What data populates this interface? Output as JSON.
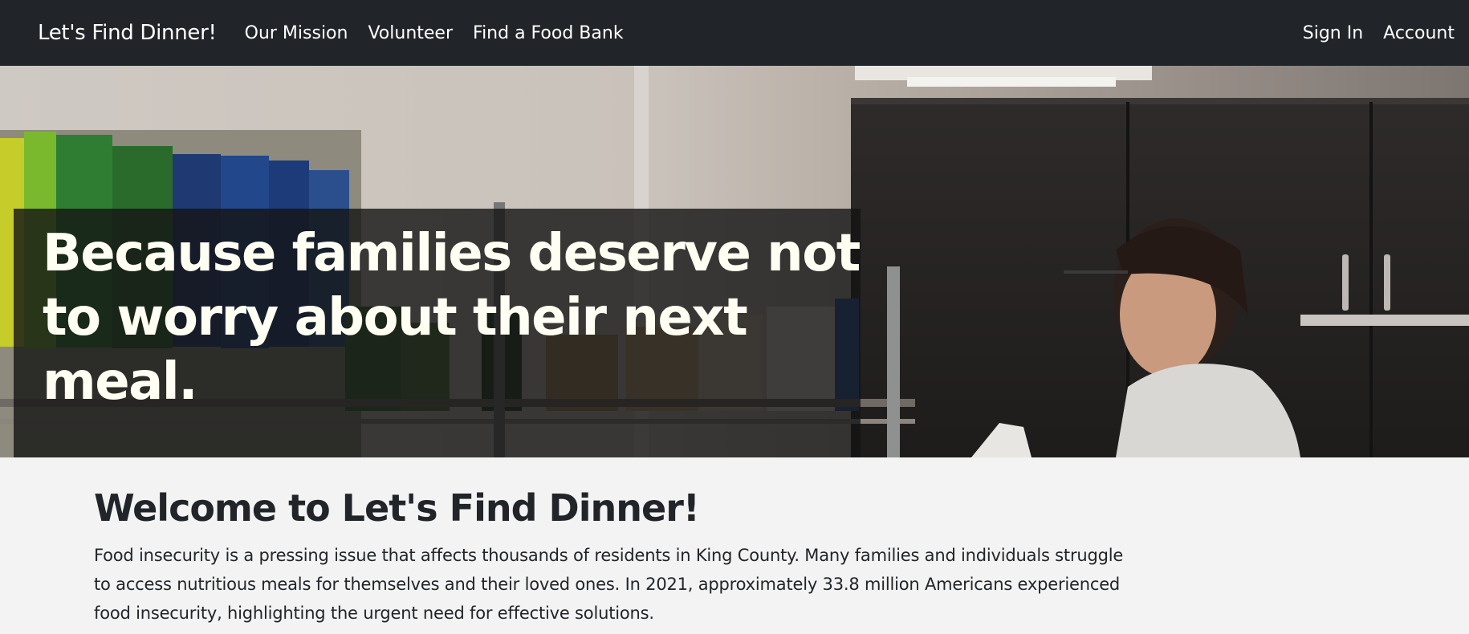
{
  "navbar": {
    "brand": "Let's Find Dinner!",
    "links": [
      {
        "label": "Our Mission"
      },
      {
        "label": "Volunteer"
      },
      {
        "label": "Find a Food Bank"
      }
    ],
    "right_links": [
      {
        "label": "Sign In"
      },
      {
        "label": "Account"
      }
    ],
    "background_color": "#212529"
  },
  "hero": {
    "title": "Because families deserve not to worry about their next meal.",
    "image_description_icon": "food-bank-photo"
  },
  "welcome": {
    "title": "Welcome to Let's Find Dinner!",
    "paragraph": "Food insecurity is a pressing issue that affects thousands of residents in King County. Many families and individuals struggle to access nutritious meals for themselves and their loved ones. In 2021, approximately 33.8 million Americans experienced food insecurity, highlighting the urgent need for effective solutions."
  }
}
